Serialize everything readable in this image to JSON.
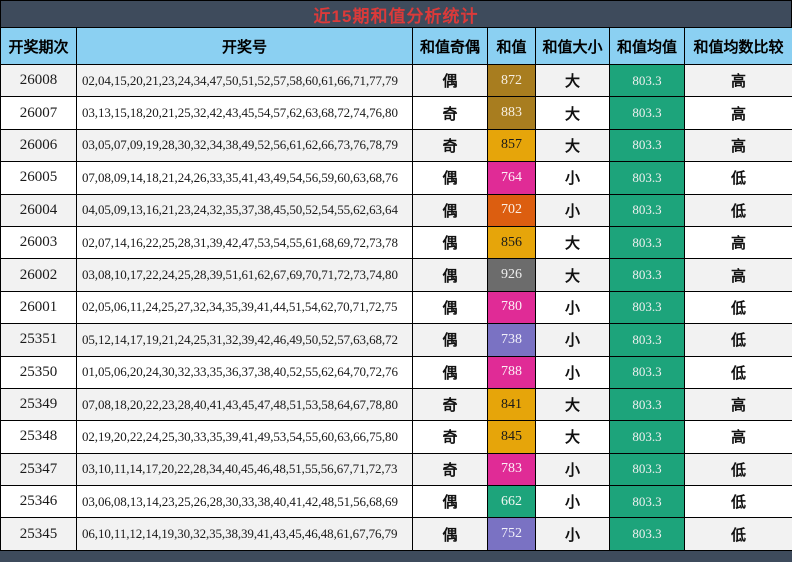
{
  "title": "近15期和值分析统计",
  "colors": {
    "frame_bg": "#3E4B5C",
    "title_fg": "#DB3A3A",
    "header_bg": "#8BD0F2",
    "row_bg": "#FFFFFF",
    "row_alt_bg": "#F2F2F2",
    "mean_bg": "#1DA47B",
    "mean_fg": "#EFEFEF",
    "border": "#000000"
  },
  "table": {
    "columns": [
      {
        "label": "开奖期次"
      },
      {
        "label": "开奖号"
      },
      {
        "label": "和值奇偶"
      },
      {
        "label": "和值"
      },
      {
        "label": "和值大小"
      },
      {
        "label": "和值均值"
      },
      {
        "label": "和值均数比较"
      }
    ],
    "rows": [
      {
        "period": "26008",
        "numbers": "02,04,15,20,21,23,24,34,47,50,51,52,57,58,60,61,66,71,77,79",
        "parity": "偶",
        "sum": "872",
        "sum_bg": "#A87D1F",
        "sum_fg": "#F7EFE2",
        "size": "大",
        "mean": "803.3",
        "compare": "高"
      },
      {
        "period": "26007",
        "numbers": "03,13,15,18,20,21,25,32,42,43,45,54,57,62,63,68,72,74,76,80",
        "parity": "奇",
        "sum": "883",
        "sum_bg": "#A87D1F",
        "sum_fg": "#F7EFE2",
        "size": "大",
        "mean": "803.3",
        "compare": "高"
      },
      {
        "period": "26006",
        "numbers": "03,05,07,09,19,28,30,32,34,38,49,52,56,61,62,66,73,76,78,79",
        "parity": "奇",
        "sum": "857",
        "sum_bg": "#E6A50A",
        "sum_fg": "#1A1A1A",
        "size": "大",
        "mean": "803.3",
        "compare": "高"
      },
      {
        "period": "26005",
        "numbers": "07,08,09,14,18,21,24,26,33,35,41,43,49,54,56,59,60,63,68,76",
        "parity": "偶",
        "sum": "764",
        "sum_bg": "#E02B96",
        "sum_fg": "#FCEFF6",
        "size": "小",
        "mean": "803.3",
        "compare": "低"
      },
      {
        "period": "26004",
        "numbers": "04,05,09,13,16,21,23,24,32,35,37,38,45,50,52,54,55,62,63,64",
        "parity": "偶",
        "sum": "702",
        "sum_bg": "#DC5E10",
        "sum_fg": "#FCF0E6",
        "size": "小",
        "mean": "803.3",
        "compare": "低"
      },
      {
        "period": "26003",
        "numbers": "02,07,14,16,22,25,28,31,39,42,47,53,54,55,61,68,69,72,73,78",
        "parity": "偶",
        "sum": "856",
        "sum_bg": "#E6A50A",
        "sum_fg": "#1A1A1A",
        "size": "大",
        "mean": "803.3",
        "compare": "高"
      },
      {
        "period": "26002",
        "numbers": "03,08,10,17,22,24,25,28,39,51,61,62,67,69,70,71,72,73,74,80",
        "parity": "偶",
        "sum": "926",
        "sum_bg": "#6C6C6C",
        "sum_fg": "#EFEFEF",
        "size": "大",
        "mean": "803.3",
        "compare": "高"
      },
      {
        "period": "26001",
        "numbers": "02,05,06,11,24,25,27,32,34,35,39,41,44,51,54,62,70,71,72,75",
        "parity": "偶",
        "sum": "780",
        "sum_bg": "#E02B96",
        "sum_fg": "#FCEFF6",
        "size": "小",
        "mean": "803.3",
        "compare": "低"
      },
      {
        "period": "25351",
        "numbers": "05,12,14,17,19,21,24,25,31,32,39,42,46,49,50,52,57,63,68,72",
        "parity": "偶",
        "sum": "738",
        "sum_bg": "#7A72C3",
        "sum_fg": "#F2F1FA",
        "size": "小",
        "mean": "803.3",
        "compare": "低"
      },
      {
        "period": "25350",
        "numbers": "01,05,06,20,24,30,32,33,35,36,37,38,40,52,55,62,64,70,72,76",
        "parity": "偶",
        "sum": "788",
        "sum_bg": "#E02B96",
        "sum_fg": "#FCEFF6",
        "size": "小",
        "mean": "803.3",
        "compare": "低"
      },
      {
        "period": "25349",
        "numbers": "07,08,18,20,22,23,28,40,41,43,45,47,48,51,53,58,64,67,78,80",
        "parity": "奇",
        "sum": "841",
        "sum_bg": "#E6A50A",
        "sum_fg": "#1A1A1A",
        "size": "大",
        "mean": "803.3",
        "compare": "高"
      },
      {
        "period": "25348",
        "numbers": "02,19,20,22,24,25,30,33,35,39,41,49,53,54,55,60,63,66,75,80",
        "parity": "奇",
        "sum": "845",
        "sum_bg": "#E6A50A",
        "sum_fg": "#1A1A1A",
        "size": "大",
        "mean": "803.3",
        "compare": "高"
      },
      {
        "period": "25347",
        "numbers": "03,10,11,14,17,20,22,28,34,40,45,46,48,51,55,56,67,71,72,73",
        "parity": "奇",
        "sum": "783",
        "sum_bg": "#E02B96",
        "sum_fg": "#FCEFF6",
        "size": "小",
        "mean": "803.3",
        "compare": "低"
      },
      {
        "period": "25346",
        "numbers": "03,06,08,13,14,23,25,26,28,30,33,38,40,41,42,48,51,56,68,69",
        "parity": "偶",
        "sum": "662",
        "sum_bg": "#1DA47B",
        "sum_fg": "#F0F7F3",
        "size": "小",
        "mean": "803.3",
        "compare": "低"
      },
      {
        "period": "25345",
        "numbers": "06,10,11,12,14,19,30,32,35,38,39,41,43,45,46,48,61,67,76,79",
        "parity": "偶",
        "sum": "752",
        "sum_bg": "#7A72C3",
        "sum_fg": "#F2F1FA",
        "size": "小",
        "mean": "803.3",
        "compare": "低"
      }
    ]
  }
}
